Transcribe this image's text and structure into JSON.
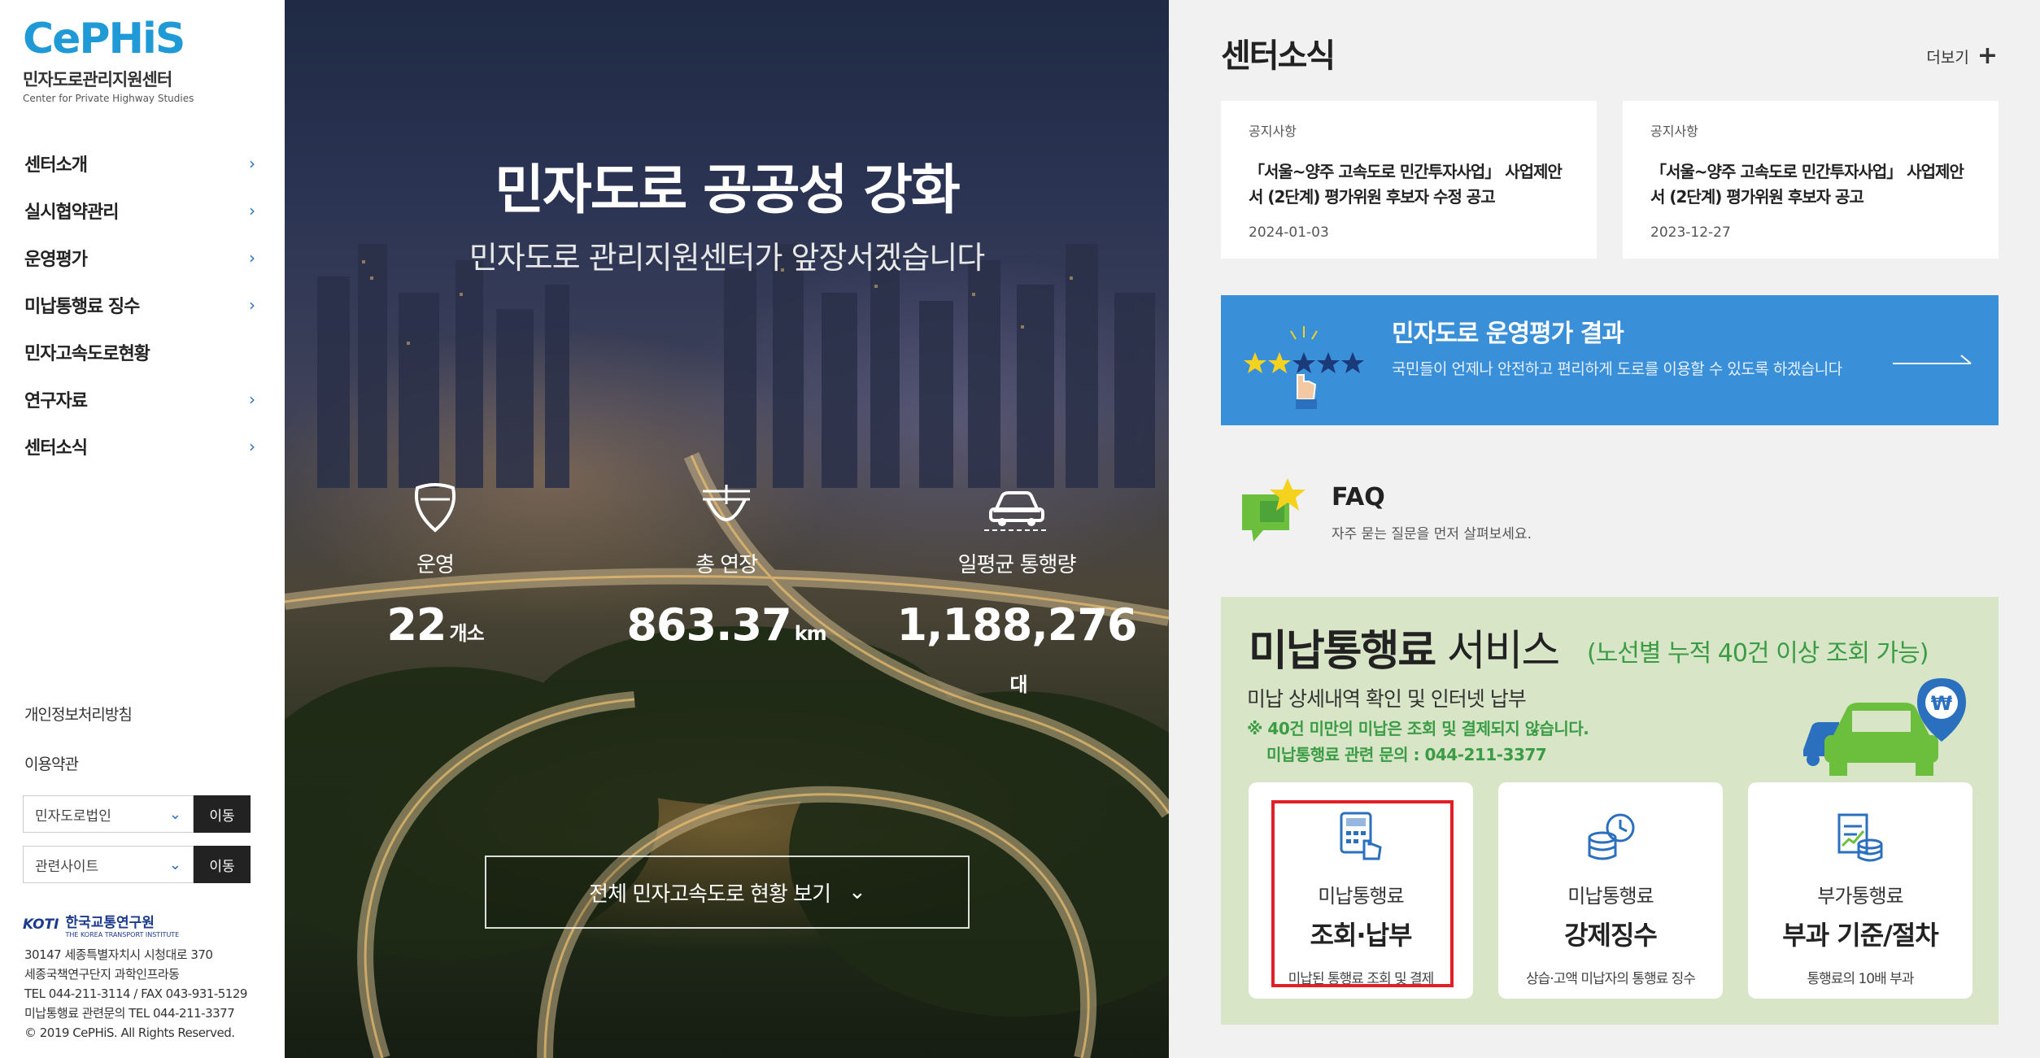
{
  "brand": {
    "logo": "CePHiS",
    "name_ko": "민자도로관리지원센터",
    "name_en": "Center for Private Highway Studies"
  },
  "nav": [
    {
      "label": "센터소개",
      "has_sub": true
    },
    {
      "label": "실시협약관리",
      "has_sub": true
    },
    {
      "label": "운영평가",
      "has_sub": true
    },
    {
      "label": "미납통행료 징수",
      "has_sub": true
    },
    {
      "label": "민자고속도로현황",
      "has_sub": false
    },
    {
      "label": "연구자료",
      "has_sub": true
    },
    {
      "label": "센터소식",
      "has_sub": true
    }
  ],
  "footer_links": {
    "privacy": "개인정보처리방침",
    "terms": "이용약관"
  },
  "selects": [
    {
      "value": "민자도로법인",
      "button": "이동"
    },
    {
      "value": "관련사이트",
      "button": "이동"
    }
  ],
  "koti": {
    "mark": "KOTI",
    "name": "한국교통연구원",
    "name_en": "THE KOREA TRANSPORT INSTITUTE"
  },
  "address": [
    "30147 세종특별자치시 시청대로 370",
    "세종국책연구단지 과학인프라동",
    "TEL 044-211-3114 / FAX 043-931-5129",
    "미납통행료 관련문의 TEL 044-211-3377",
    "© 2019 CePHiS. All Rights Reserved."
  ],
  "hero": {
    "title": "민자도로 공공성 강화",
    "subtitle": "민자도로 관리지원센터가 앞장서겠습니다",
    "stats": [
      {
        "icon": "highway-shield-icon",
        "label": "운영",
        "value": "22",
        "unit": "개소"
      },
      {
        "icon": "road-length-icon",
        "label": "총 연장",
        "value": "863.37",
        "unit": "km"
      },
      {
        "icon": "car-traffic-icon",
        "label": "일평균 통행량",
        "value": "1,188,276",
        "unit": "대"
      }
    ],
    "button": "전체 민자고속도로 현황 보기"
  },
  "news": {
    "title": "센터소식",
    "more": "더보기",
    "cards": [
      {
        "category": "공지사항",
        "title": "「서울~양주 고속도로 민간투자사업」 사업제안서 (2단계) 평가위원 후보자 수정 공고",
        "date": "2024-01-03"
      },
      {
        "category": "공지사항",
        "title": "「서울~양주 고속도로 민간투자사업」 사업제안서 (2단계) 평가위원 후보자 공고",
        "date": "2023-12-27"
      }
    ]
  },
  "evaluation": {
    "title": "민자도로 운영평가 결과",
    "desc": "국민들이 언제나 안전하고 편리하게 도로를 이용할 수 있도록 하겠습니다"
  },
  "faq": {
    "title": "FAQ",
    "desc": "자주 묻는 질문을 먼저 살펴보세요."
  },
  "unpaid": {
    "title_bold": "미납통행료",
    "title_rest": " 서비스",
    "note": "(노선별 누적 40건 이상 조회 가능)",
    "subtitle": "미납 상세내역 확인 및 인터넷 납부",
    "warning1": "※ 40건 미만의 미납은 조회 및 결제되지 않습니다.",
    "warning2": "미납통행료 관련 문의 : 044-211-3377",
    "services": [
      {
        "line1": "미납통행료",
        "line2": "조회·납부",
        "desc": "미납된 통행료 조회 및 결제"
      },
      {
        "line1": "미납통행료",
        "line2": "강제징수",
        "desc": "상습·고액 미납자의 통행료 징수"
      },
      {
        "line1": "부가통행료",
        "line2": "부과 기준/절차",
        "desc": "통행료의 10배 부과"
      }
    ]
  },
  "colors": {
    "accent_blue": "#3a8fd9",
    "green_text": "#3a9c45",
    "panel_green": "#d8e6c7",
    "highlight_red": "#e01f26"
  }
}
